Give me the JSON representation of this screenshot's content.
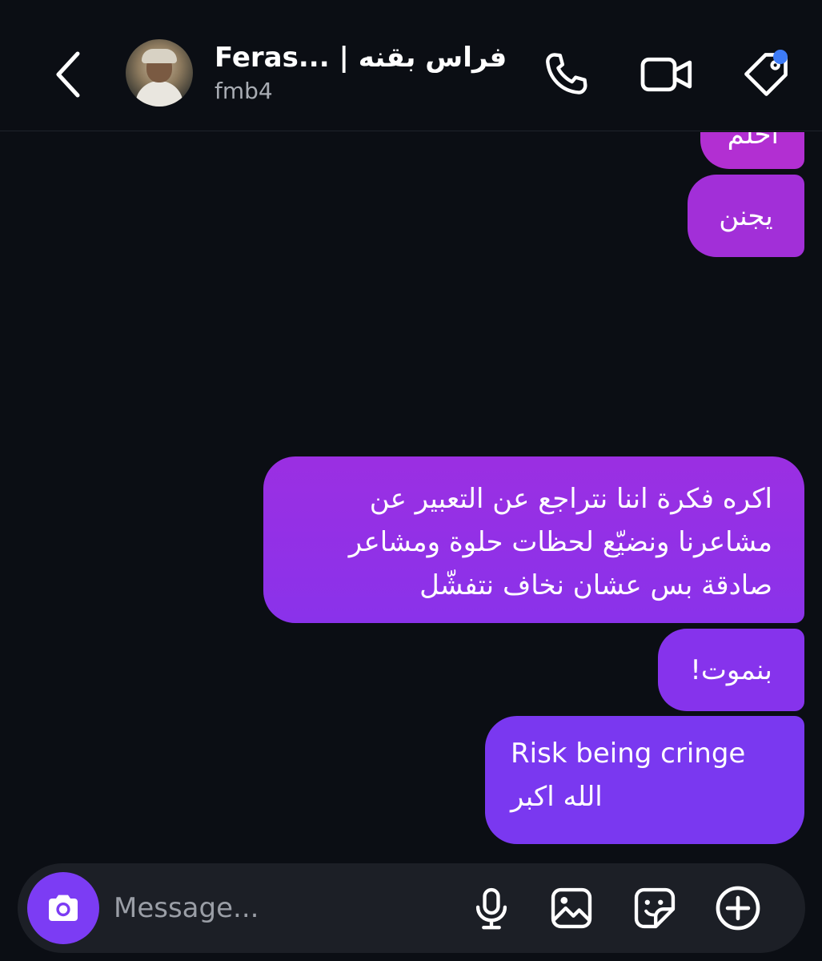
{
  "header": {
    "title": "Feras... | فراس بقنه",
    "username": "fmb4",
    "icons": {
      "back": "chevron-left-icon",
      "call": "phone-icon",
      "video": "video-camera-icon",
      "tag": "tag-icon"
    },
    "badge_color": "#3d7bf7"
  },
  "messages": [
    {
      "text": "احلم"
    },
    {
      "text": "يجنن"
    },
    {
      "text": "اكره فكرة اننا نتراجع عن التعبير عن مشاعرنا ونضيّع لحظات حلوة ومشاعر صادقة بس عشان نخاف نتفشّل"
    },
    {
      "text": "بنموت!"
    },
    {
      "line1": "Risk being cringe",
      "line2": "الله اكبر"
    }
  ],
  "composer": {
    "placeholder": "Message...",
    "icons": [
      "camera-icon",
      "microphone-icon",
      "image-icon",
      "sticker-icon",
      "plus-circle-icon"
    ]
  },
  "colors": {
    "background": "#0b0e14",
    "accent": "#7c3cf4"
  }
}
